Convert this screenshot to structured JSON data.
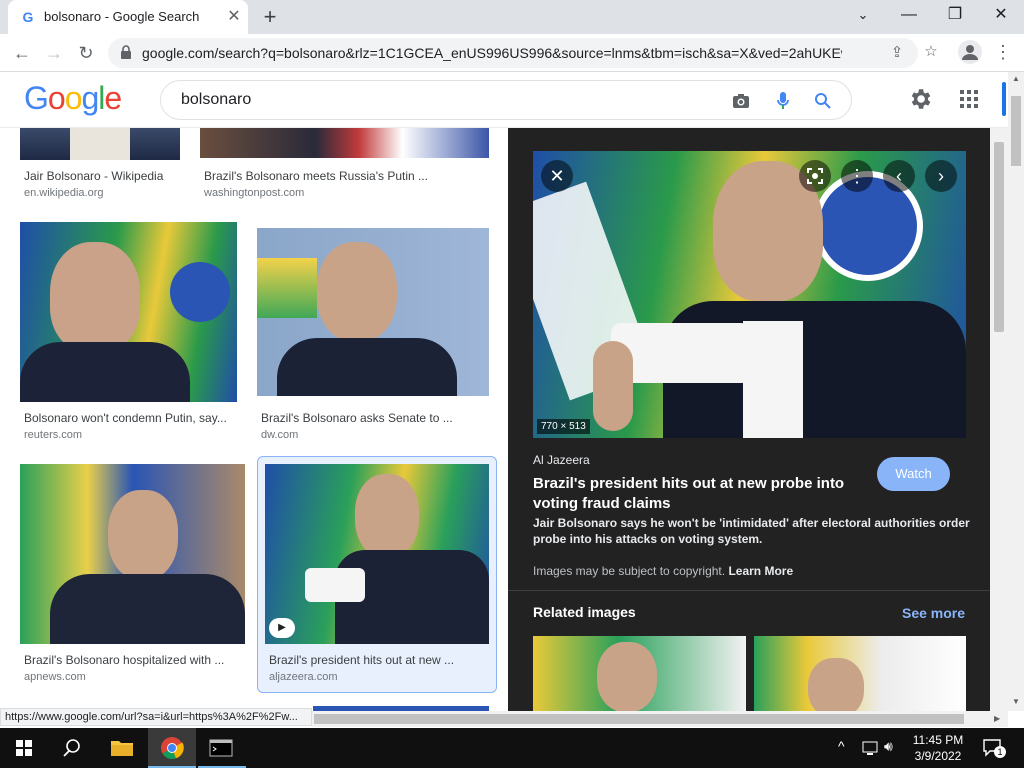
{
  "browser": {
    "tab_title": "bolsonaro - Google Search",
    "url": "google.com/search?q=bolsonaro&rlz=1C1GCEA_enUS996US996&source=lnms&tbm=isch&sa=X&ved=2ahUKEwiysa..."
  },
  "search": {
    "query": "bolsonaro"
  },
  "results": [
    {
      "caption": "Jair Bolsonaro - Wikipedia",
      "source": "en.wikipedia.org"
    },
    {
      "caption": "Brazil's Bolsonaro meets Russia's Putin ...",
      "source": "washingtonpost.com"
    },
    {
      "caption": "Bolsonaro won't condemn Putin, say...",
      "source": "reuters.com"
    },
    {
      "caption": "Brazil's Bolsonaro asks Senate to ...",
      "source": "dw.com"
    },
    {
      "caption": "Brazil's Bolsonaro hospitalized with ...",
      "source": "apnews.com"
    },
    {
      "caption": "Brazil's president hits out at new ...",
      "source": "aljazeera.com"
    }
  ],
  "panel": {
    "dimensions": "770 × 513",
    "publisher": "Al Jazeera",
    "headline": "Brazil's president hits out at new probe into voting fraud claims",
    "description": "Jair Bolsonaro says he won't be 'intimidated' after electoral authorities order probe into his attacks on voting system.",
    "watch_label": "Watch",
    "copyright_text": "Images may be subject to copyright.",
    "learn_more": "Learn More",
    "related_title": "Related images",
    "see_more": "See more"
  },
  "status_url": "https://www.google.com/url?sa=i&url=https%3A%2F%2Fw...",
  "clock": {
    "time": "11:45 PM",
    "date": "3/9/2022"
  },
  "notification_count": "1",
  "colors": {
    "accent": "#1a73e8",
    "watch_button": "#8ab4f8",
    "panel_bg": "#222222"
  }
}
